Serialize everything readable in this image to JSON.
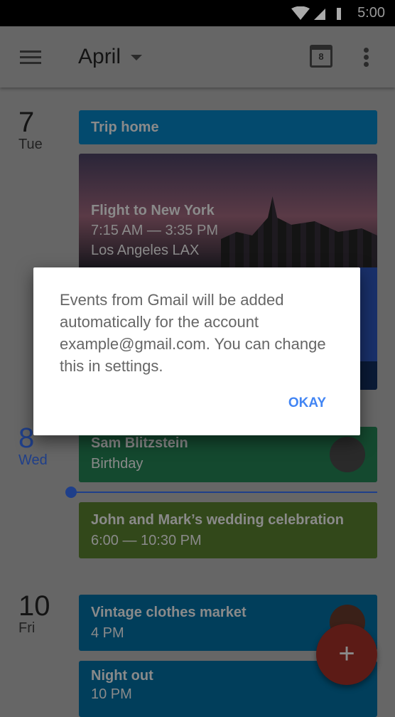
{
  "status_bar": {
    "time": "5:00",
    "icons": [
      "wifi-icon",
      "signal-icon",
      "battery-icon"
    ]
  },
  "app_bar": {
    "title": "April",
    "calendar_day": "8"
  },
  "days": [
    {
      "number": "7",
      "weekday": "Tue"
    },
    {
      "number": "8",
      "weekday": "Wed"
    },
    {
      "number": "10",
      "weekday": "Fri"
    }
  ],
  "events": {
    "trip": {
      "title": "Trip home"
    },
    "flight": {
      "title": "Flight to New York",
      "time": "7:15 AM — 3:35 PM",
      "location": "Los Angeles LAX"
    },
    "birthday": {
      "title": "Sam Blitzstein",
      "subtitle": "Birthday"
    },
    "wedding": {
      "title": "John and Mark’s wedding celebration",
      "time": "6:00 — 10:30 PM"
    },
    "market": {
      "title": "Vintage clothes market",
      "time": "4 PM"
    },
    "night": {
      "title": "Night out",
      "time": "10 PM"
    }
  },
  "colors": {
    "blue": "#039be5",
    "green": "#33b679",
    "olive": "#7cb342",
    "accent": "#3367d6",
    "fab": "#e53935",
    "button": "#4285f4"
  },
  "dialog": {
    "message": "Events from Gmail will be added automatically for the account example@gmail.com. You can change this in settings.",
    "ok_label": "OKAY"
  },
  "fab": {
    "label": "+"
  }
}
